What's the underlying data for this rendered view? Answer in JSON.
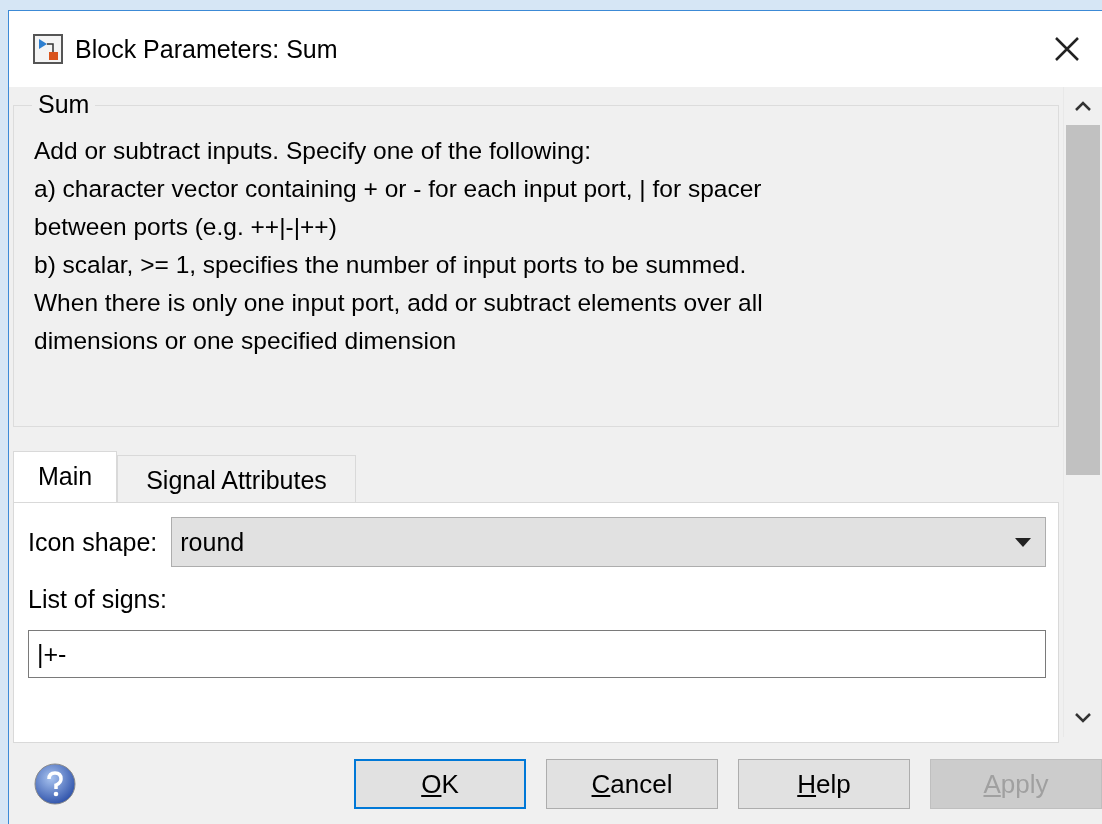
{
  "window": {
    "title": "Block Parameters: Sum"
  },
  "group": {
    "title": "Sum",
    "description": [
      "Add or subtract inputs.  Specify one of the following:",
      "a) character vector containing + or - for each input port, | for spacer",
      "between ports (e.g. ++|-|++)",
      "b) scalar, >= 1, specifies the number of input ports to be summed.",
      "When there is only one input port, add or subtract elements over all",
      "dimensions or one specified dimension"
    ]
  },
  "tabs": [
    {
      "label": "Main",
      "selected": true
    },
    {
      "label": "Signal Attributes",
      "selected": false
    }
  ],
  "fields": [
    {
      "kind": "dropdown",
      "label": "Icon shape:",
      "value": "round"
    },
    {
      "kind": "text",
      "label": "List of signs:",
      "value": "|+-"
    }
  ],
  "buttons": [
    {
      "label": "OK",
      "default": true,
      "disabled": false
    },
    {
      "label": "Cancel",
      "default": false,
      "disabled": false
    },
    {
      "label": "Help",
      "default": false,
      "disabled": false
    },
    {
      "label": "Apply",
      "default": false,
      "disabled": true
    }
  ]
}
